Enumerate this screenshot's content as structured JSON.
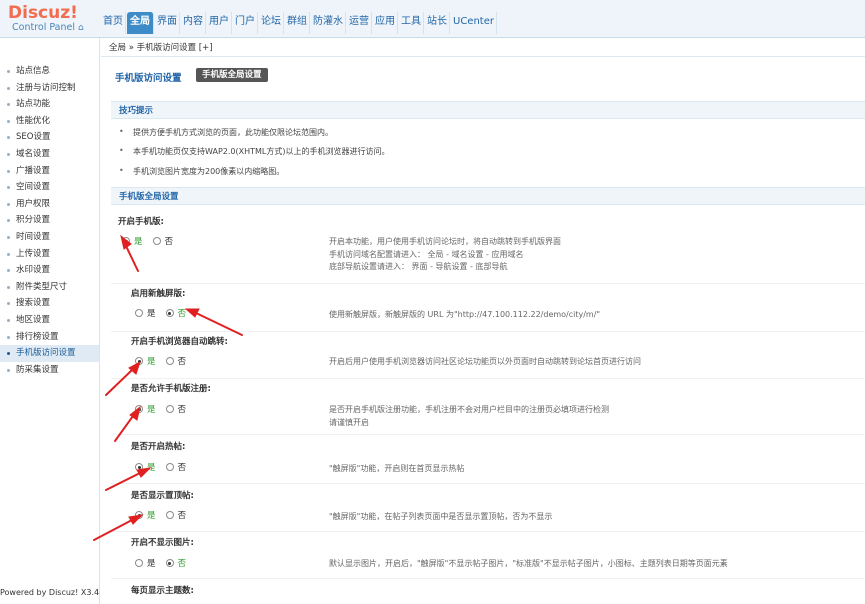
{
  "brand": {
    "name": "Discuz!",
    "sub": "Control Panel",
    "home_icon": "home-icon"
  },
  "topnav": [
    "首页",
    "全局",
    "界面",
    "内容",
    "用户",
    "门户",
    "论坛",
    "群组",
    "防灌水",
    "运营",
    "应用",
    "工具",
    "站长",
    "UCenter"
  ],
  "breadcrumb": "全局 » 手机版访问设置  [+]",
  "sidebar": [
    "站点信息",
    "注册与访问控制",
    "站点功能",
    "性能优化",
    "SEO设置",
    "域名设置",
    "广播设置",
    "空间设置",
    "用户权限",
    "积分设置",
    "时间设置",
    "上传设置",
    "水印设置",
    "附件类型尺寸",
    "搜索设置",
    "地区设置",
    "排行榜设置",
    "手机版访问设置",
    "防采集设置"
  ],
  "powered": "Powered by Discuz! X3.4",
  "page": {
    "title": "手机版访问设置",
    "tab": "手机版全局设置"
  },
  "tips": {
    "header": "技巧提示",
    "items": [
      "提供方便手机方式浏览的页面，此功能仅限论坛范围内。",
      "本手机功能页仅支持WAP2.0(XHTML方式)以上的手机浏览器进行访问。",
      "手机浏览图片宽度为200像素以内缩略图。"
    ]
  },
  "global_header": "手机版全局设置",
  "settings": [
    {
      "label": "开启手机版:",
      "yes": "是",
      "no": "否",
      "selected": "yes",
      "desc": [
        "开启本功能，用户使用手机访问论坛时，将自动跳转到手机版界面",
        "手机访问域名配置请进入： 全局 - 域名设置 - 应用域名",
        "底部导航设置请进入： 界面 - 导航设置 - 底部导航"
      ]
    },
    {
      "label": "启用新触屏版:",
      "yes": "是",
      "no": "否",
      "selected": "no",
      "desc": [
        "使用新触屏版，新触屏版的 URL 为\"http://47.100.112.22/demo/city/m/\""
      ]
    },
    {
      "label": "开启手机浏览器自动跳转:",
      "yes": "是",
      "no": "否",
      "selected": "yes",
      "desc": [
        "开启后用户使用手机浏览器访问社区论坛功能页以外页面时自动跳转到论坛首页进行访问"
      ]
    },
    {
      "label": "是否允许手机版注册:",
      "yes": "是",
      "no": "否",
      "selected": "yes",
      "desc": [
        "是否开启手机版注册功能，手机注册不会对用户栏目中的注册页必填项进行检测",
        "请谨慎开启"
      ]
    },
    {
      "label": "是否开启热帖:",
      "yes": "是",
      "no": "否",
      "selected": "yes",
      "desc": [
        "\"触屏版\"功能，开启则在首页显示热帖"
      ]
    },
    {
      "label": "是否显示置顶帖:",
      "yes": "是",
      "no": "否",
      "selected": "yes",
      "desc": [
        "\"触屏版\"功能，在帖子列表页面中是否显示置顶帖，否为不显示"
      ]
    },
    {
      "label": "开启不显示图片:",
      "yes": "是",
      "no": "否",
      "selected": "no",
      "desc": [
        "默认显示图片，开启后，\"触屏版\"不显示帖子图片，\"标准版\"不显示帖子图片，小图标、主题列表日期等页面元素"
      ]
    },
    {
      "label": "每页显示主题数:"
    }
  ],
  "colors": {
    "accent": "#3e8cc7",
    "brand": "#f26c4f",
    "arrow": "#e02020",
    "selected_option": "#2f9e2f"
  }
}
